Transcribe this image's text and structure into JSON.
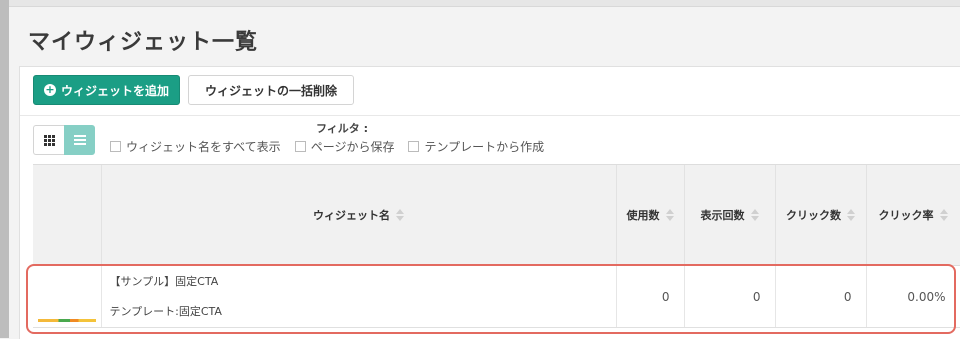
{
  "page": {
    "title": "マイウィジェット一覧"
  },
  "toolbar": {
    "add_label": "ウィジェットを追加",
    "bulk_delete_label": "ウィジェットの一括削除"
  },
  "filters": {
    "label": "フィルタ :",
    "options": [
      "ウィジェット名をすべて表示",
      "ページから保存",
      "テンプレートから作成"
    ]
  },
  "table": {
    "columns": [
      "ウィジェット名",
      "使用数",
      "表示回数",
      "クリック数",
      "クリック率"
    ],
    "rows": [
      {
        "name": "【サンプル】固定CTA",
        "template": "テンプレート:固定CTA",
        "uses": "0",
        "views": "0",
        "clicks": "0",
        "ctr": "0.00%"
      }
    ]
  },
  "colors": {
    "accent": "#1b9e85",
    "highlight": "#e36a60",
    "list_view_active": "#86cfc5"
  },
  "icons": {
    "add": "plus-circle-icon",
    "grid_view": "grid-icon",
    "list_view": "list-icon",
    "sort": "sort-icon"
  }
}
